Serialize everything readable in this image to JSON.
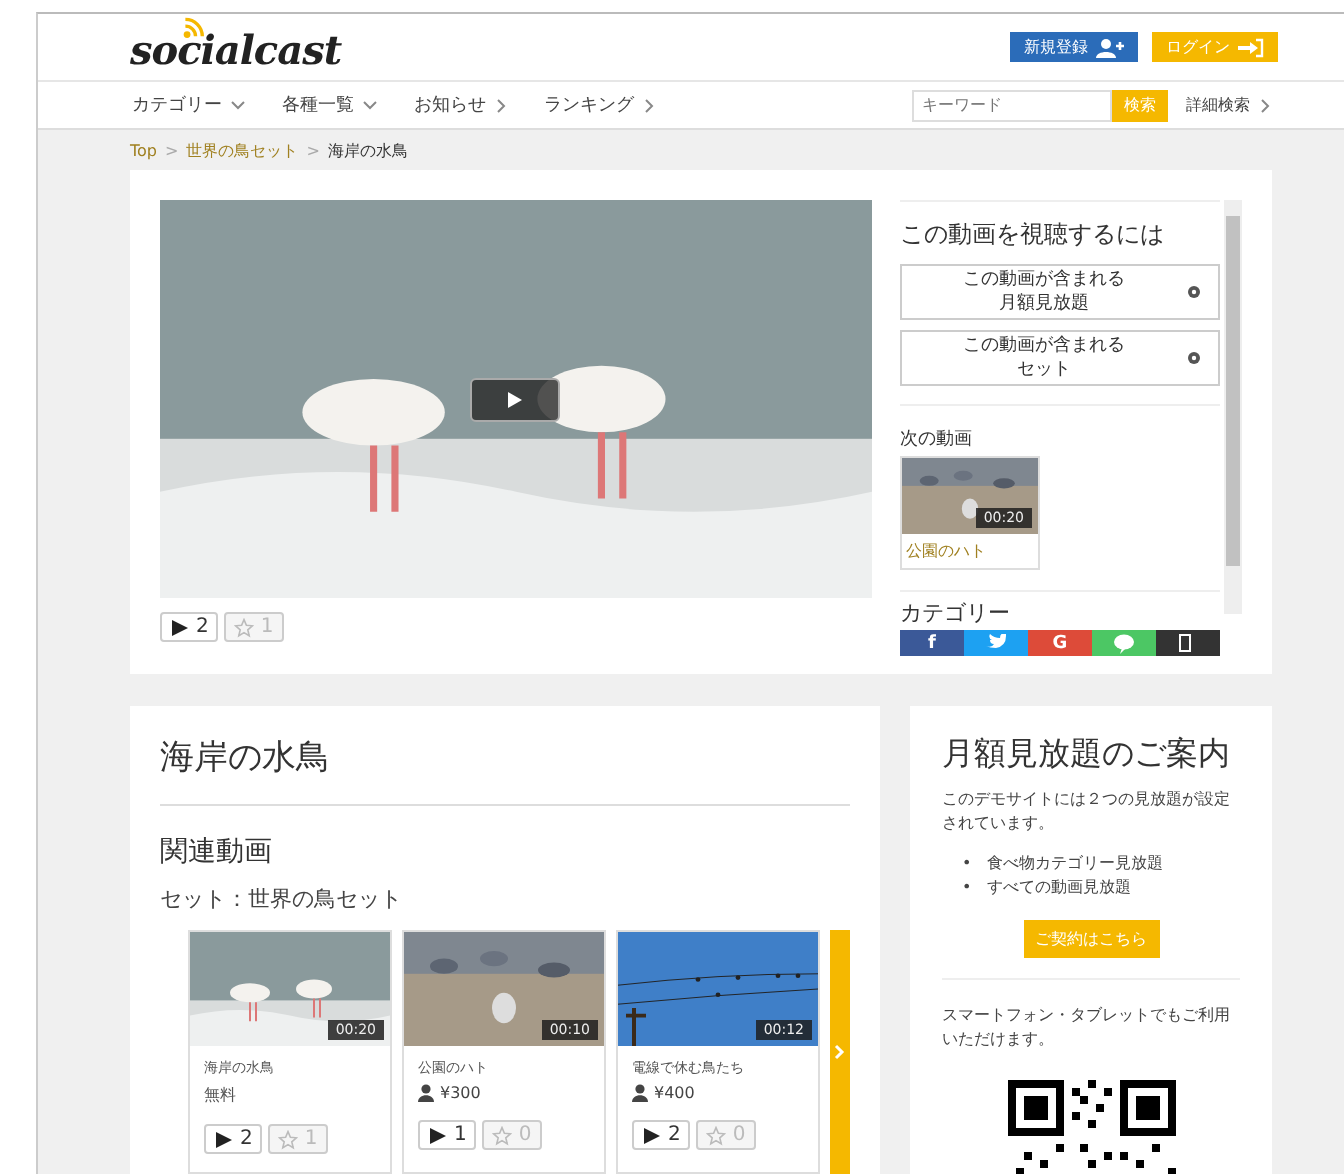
{
  "header": {
    "logo": "socialcast",
    "register_button": "新規登録",
    "login_button": "ログイン"
  },
  "nav": {
    "items": [
      {
        "label": "カテゴリー",
        "kind": "dropdown"
      },
      {
        "label": "各種一覧",
        "kind": "dropdown"
      },
      {
        "label": "お知らせ",
        "kind": "link"
      },
      {
        "label": "ランキング",
        "kind": "link"
      }
    ],
    "search": {
      "placeholder": "キーワード",
      "button": "検索"
    },
    "advanced_search": "詳細検索"
  },
  "breadcrumb": [
    {
      "label": "Top",
      "kind": "link"
    },
    {
      "label": ">",
      "kind": "separator"
    },
    {
      "label": "世界の鳥セット",
      "kind": "link"
    },
    {
      "label": ">",
      "kind": "separator"
    },
    {
      "label": "海岸の水鳥",
      "kind": "current"
    }
  ],
  "player": {
    "plays": "2",
    "favorites": "1"
  },
  "purchase": {
    "title": "この動画を視聴するには",
    "options": [
      {
        "lines": [
          "この動画が含まれる",
          "月額見放題"
        ]
      },
      {
        "lines": [
          "この動画が含まれる",
          "セット"
        ]
      }
    ],
    "next_heading": "次の動画",
    "next_video": {
      "duration": "00:20",
      "title": "公園のハト"
    },
    "category_heading": "カテゴリー",
    "share": [
      {
        "kind": "facebook",
        "glyph": "f",
        "color": "#3b5998"
      },
      {
        "kind": "twitter",
        "color": "#1da1f2"
      },
      {
        "kind": "google",
        "glyph": "G",
        "color": "#dd4b39"
      },
      {
        "kind": "line",
        "color": "#4cc764"
      },
      {
        "kind": "other",
        "color": "#333333"
      }
    ]
  },
  "video_title": "海岸の水鳥",
  "related": {
    "heading": "関連動画",
    "set_label": "セット：世界の鳥セット",
    "videos": [
      {
        "title": "海岸の水鳥",
        "price": "無料",
        "kind": "free",
        "duration": "00:20",
        "plays": "2",
        "favorites": "1"
      },
      {
        "title": "公園のハト",
        "price": "¥300",
        "kind": "paid",
        "duration": "00:10",
        "plays": "1",
        "favorites": "0"
      },
      {
        "title": "電線で休む鳥たち",
        "price": "¥400",
        "kind": "paid",
        "duration": "00:12",
        "plays": "2",
        "favorites": "0"
      }
    ]
  },
  "promo": {
    "title": "月額見放題のご案内",
    "text": "このデモサイトには２つの見放題が設定されています。",
    "items": [
      {
        "bullet": "•",
        "text": "食べ物カテゴリー見放題"
      },
      {
        "bullet": "•",
        "text": "すべての動画見放題"
      }
    ],
    "button": "ご契約はこちら",
    "mobile_text": "スマートフォン・タブレットでもご利用いただけます。"
  }
}
